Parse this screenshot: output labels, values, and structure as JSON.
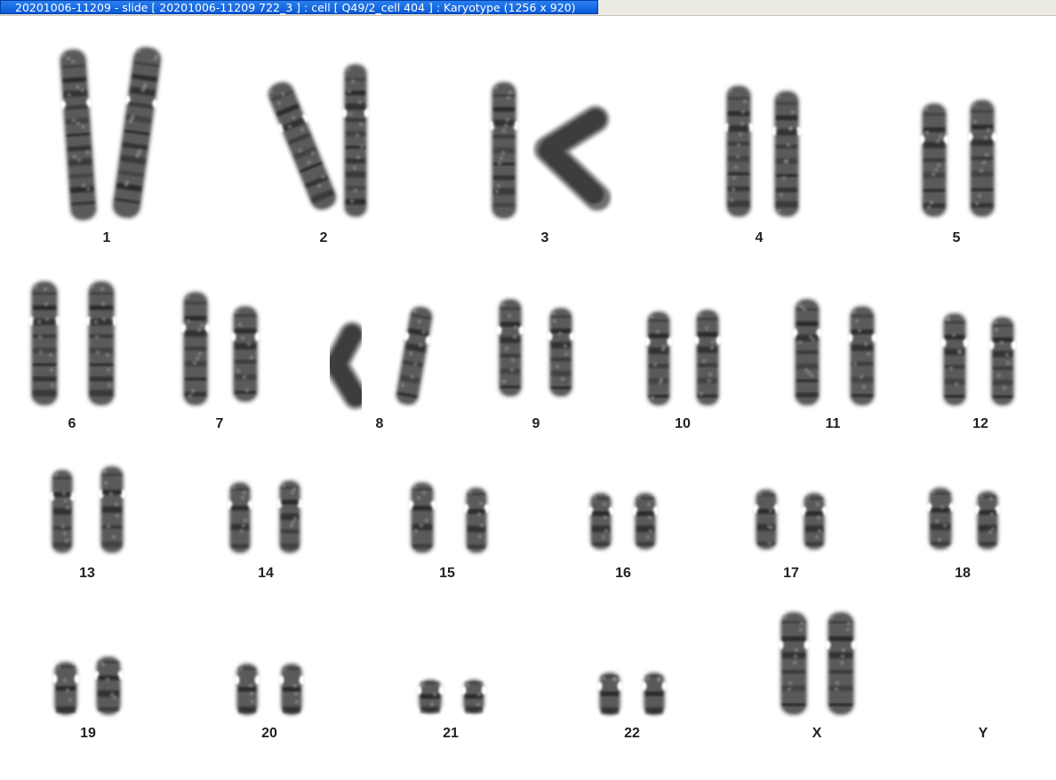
{
  "window": {
    "title": "20201006-11209 - slide [ 20201006-11209 722_3 ] : cell [ Q49/2_cell 404 ] : Karyotype  (1256 x 920)"
  },
  "karyotype": {
    "labels": [
      "1",
      "2",
      "3",
      "4",
      "5",
      "6",
      "7",
      "8",
      "9",
      "10",
      "11",
      "12",
      "13",
      "14",
      "15",
      "16",
      "17",
      "18",
      "19",
      "20",
      "21",
      "22",
      "X",
      "Y"
    ],
    "chromosome_fill": "#4a4a4a",
    "band_color": "#121212",
    "background": "#ffffff"
  }
}
